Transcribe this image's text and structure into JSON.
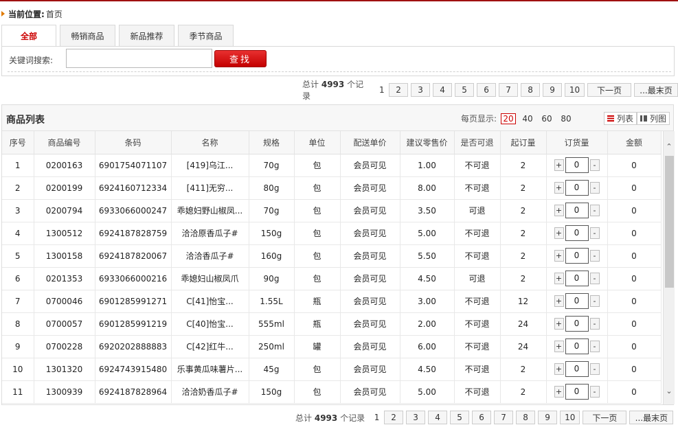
{
  "breadcrumb": {
    "label": "当前位置:",
    "current": "首页"
  },
  "tabs": [
    {
      "label": "全部",
      "active": true
    },
    {
      "label": "畅销商品",
      "active": false
    },
    {
      "label": "新品推荐",
      "active": false
    },
    {
      "label": "季节商品",
      "active": false
    }
  ],
  "search": {
    "label": "关键词搜索:",
    "value": "",
    "placeholder": "",
    "button": "查找"
  },
  "pager": {
    "total_prefix": "总计",
    "total_count": "4993",
    "total_suffix": "个记录",
    "current_page": "1",
    "pages": [
      "2",
      "3",
      "4",
      "5",
      "6",
      "7",
      "8",
      "9",
      "10"
    ],
    "next": "下一页",
    "last": "...最末页"
  },
  "list": {
    "title": "商品列表",
    "per_page_label": "每页显示:",
    "per_page_options": [
      "20",
      "40",
      "60",
      "80"
    ],
    "per_page_selected": "20",
    "view_list": "列表",
    "view_grid": "列图",
    "columns": [
      "序号",
      "商品编号",
      "条码",
      "名称",
      "规格",
      "单位",
      "配送单价",
      "建议零售价",
      "是否可退",
      "起订量",
      "订货量",
      "金额"
    ],
    "rows": [
      {
        "no": "1",
        "code": "0200163",
        "barcode": "6901754071107",
        "name": "[419]乌江...",
        "spec": "70g",
        "unit": "包",
        "price": "会员可见",
        "retail": "1.00",
        "returnable": "不可退",
        "moq": "2",
        "qty": "0",
        "amount": "0"
      },
      {
        "no": "2",
        "code": "0200199",
        "barcode": "6924160712334",
        "name": "[411]无穷...",
        "spec": "80g",
        "unit": "包",
        "price": "会员可见",
        "retail": "8.00",
        "returnable": "不可退",
        "moq": "2",
        "qty": "0",
        "amount": "0"
      },
      {
        "no": "3",
        "code": "0200794",
        "barcode": "6933066000247",
        "name": "乖媳妇野山椒凤...",
        "spec": "70g",
        "unit": "包",
        "price": "会员可见",
        "retail": "3.50",
        "returnable": "可退",
        "moq": "2",
        "qty": "0",
        "amount": "0"
      },
      {
        "no": "4",
        "code": "1300512",
        "barcode": "6924187828759",
        "name": "洽洽原香瓜子#",
        "spec": "150g",
        "unit": "包",
        "price": "会员可见",
        "retail": "5.00",
        "returnable": "不可退",
        "moq": "2",
        "qty": "0",
        "amount": "0"
      },
      {
        "no": "5",
        "code": "1300158",
        "barcode": "6924187820067",
        "name": "洽洽香瓜子#",
        "spec": "160g",
        "unit": "包",
        "price": "会员可见",
        "retail": "5.50",
        "returnable": "不可退",
        "moq": "2",
        "qty": "0",
        "amount": "0"
      },
      {
        "no": "6",
        "code": "0201353",
        "barcode": "6933066000216",
        "name": "乖媳妇山椒凤爪",
        "spec": "90g",
        "unit": "包",
        "price": "会员可见",
        "retail": "4.50",
        "returnable": "可退",
        "moq": "2",
        "qty": "0",
        "amount": "0"
      },
      {
        "no": "7",
        "code": "0700046",
        "barcode": "6901285991271",
        "name": "C[41]怡宝...",
        "spec": "1.55L",
        "unit": "瓶",
        "price": "会员可见",
        "retail": "3.00",
        "returnable": "不可退",
        "moq": "12",
        "qty": "0",
        "amount": "0"
      },
      {
        "no": "8",
        "code": "0700057",
        "barcode": "6901285991219",
        "name": "C[40]怡宝...",
        "spec": "555ml",
        "unit": "瓶",
        "price": "会员可见",
        "retail": "2.00",
        "returnable": "不可退",
        "moq": "24",
        "qty": "0",
        "amount": "0"
      },
      {
        "no": "9",
        "code": "0700228",
        "barcode": "6920202888883",
        "name": "C[42]红牛...",
        "spec": "250ml",
        "unit": "罐",
        "price": "会员可见",
        "retail": "6.00",
        "returnable": "不可退",
        "moq": "24",
        "qty": "0",
        "amount": "0"
      },
      {
        "no": "10",
        "code": "1301320",
        "barcode": "6924743915480",
        "name": "乐事黄瓜味薯片...",
        "spec": "45g",
        "unit": "包",
        "price": "会员可见",
        "retail": "4.50",
        "returnable": "不可退",
        "moq": "2",
        "qty": "0",
        "amount": "0"
      },
      {
        "no": "11",
        "code": "1300939",
        "barcode": "6924187828964",
        "name": "洽洽奶香瓜子#",
        "spec": "150g",
        "unit": "包",
        "price": "会员可见",
        "retail": "5.00",
        "returnable": "不可退",
        "moq": "2",
        "qty": "0",
        "amount": "0"
      }
    ]
  },
  "stepper": {
    "plus": "+",
    "minus": "-"
  },
  "colors": {
    "accent": "#c00000",
    "link": "#2a62b8",
    "price": "#e07a00",
    "topline": "#a01010"
  }
}
